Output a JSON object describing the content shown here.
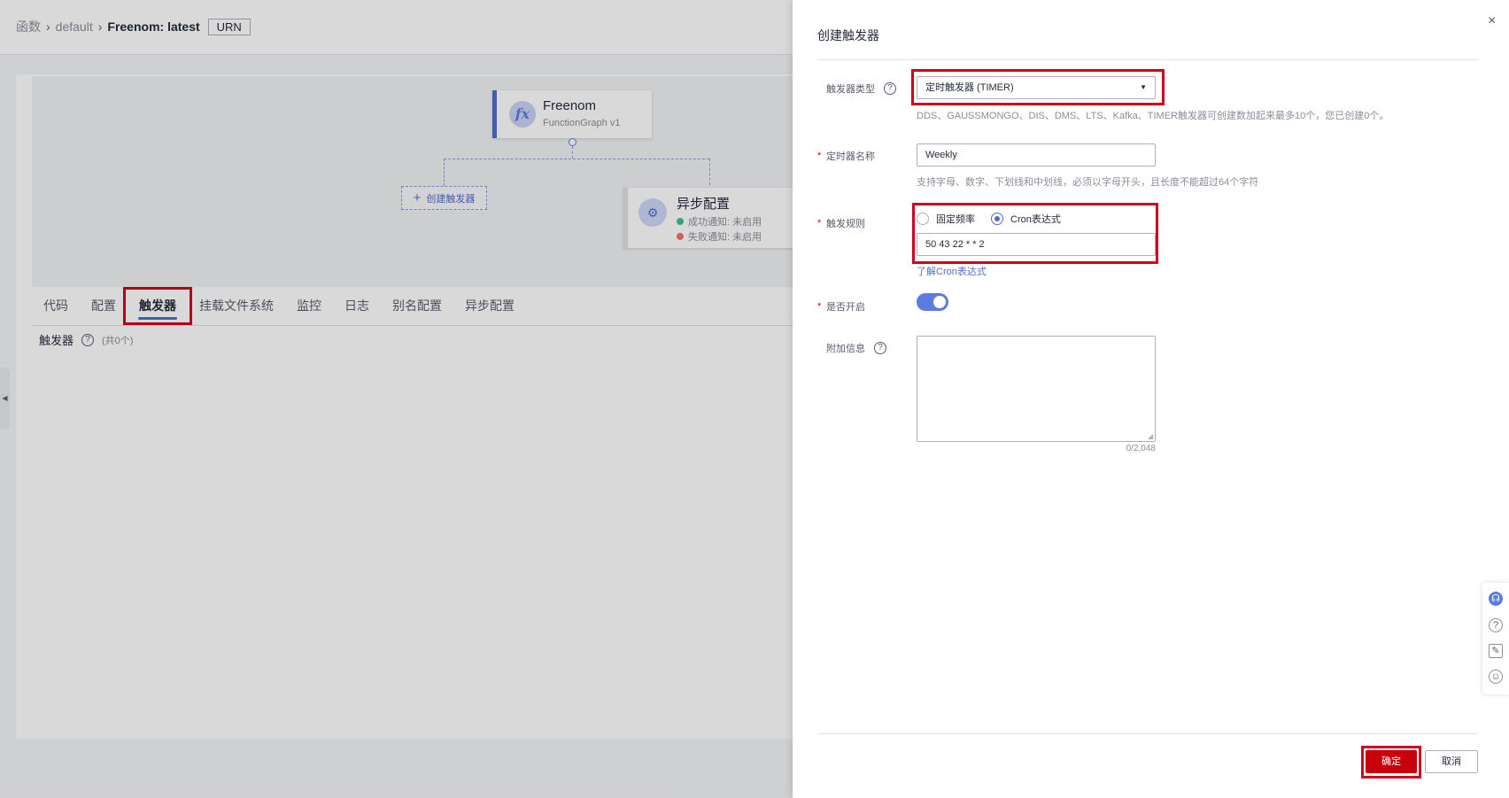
{
  "breadcrumb": {
    "root": "函数",
    "sep": "›",
    "group": "default",
    "current": "Freenom: latest",
    "urn_tag": "URN"
  },
  "canvas": {
    "function_name": "Freenom",
    "function_sub": "FunctionGraph v1",
    "function_icon": "fx",
    "create_trigger_label": "创建触发器",
    "async": {
      "title": "异步配置",
      "success": "成功通知: 未启用",
      "failure": "失败通知: 未启用"
    }
  },
  "tabs": [
    "代码",
    "配置",
    "触发器",
    "挂载文件系统",
    "监控",
    "日志",
    "别名配置",
    "异步配置"
  ],
  "trigger_section": {
    "title": "触发器",
    "count": "(共0个)"
  },
  "drawer": {
    "title": "创建触发器",
    "close": "×",
    "trigger_type": {
      "label": "触发器类型",
      "value": "定时触发器 (TIMER)",
      "hint": "DDS、GAUSSMONGO、DIS、DMS、LTS、Kafka、TIMER触发器可创建数加起来最多10个，您已创建0个。"
    },
    "timer_name": {
      "label": "定时器名称",
      "value": "Weekly",
      "hint": "支持字母、数字、下划线和中划线，必须以字母开头，且长度不能超过64个字符"
    },
    "trigger_rule": {
      "label": "触发规则",
      "options": [
        "固定频率",
        "Cron表达式"
      ],
      "selected": "Cron表达式",
      "value": "50 43 22 * * 2",
      "link": "了解Cron表达式"
    },
    "enabled": {
      "label": "是否开启",
      "value": true
    },
    "additional_info": {
      "label": "附加信息",
      "value": "",
      "counter": "0/2,048"
    },
    "confirm_label": "确定",
    "cancel_label": "取消"
  },
  "colors": {
    "accent": "#526ecc",
    "danger": "#c7000b",
    "highlight": "#d0021b"
  },
  "float_bar_icons": [
    "headset-icon",
    "help-icon",
    "feedback-icon",
    "smile-icon"
  ]
}
